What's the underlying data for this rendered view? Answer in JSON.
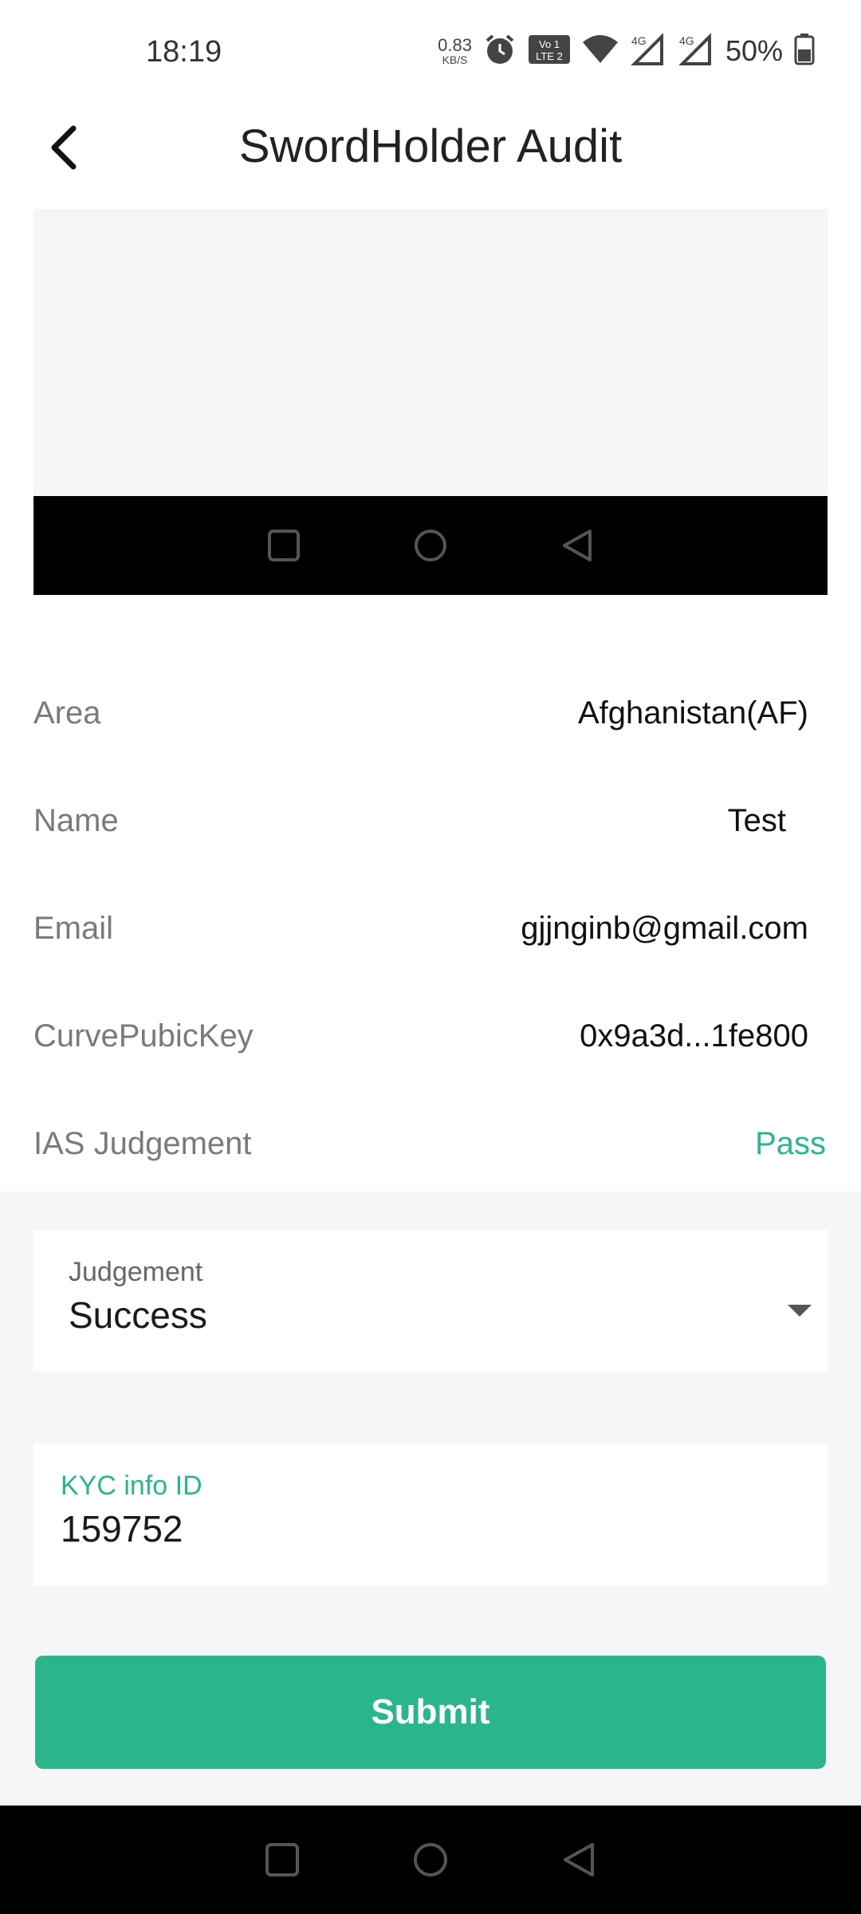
{
  "status_bar": {
    "time": "18:19",
    "net_speed_value": "0.83",
    "net_speed_unit": "KB/S",
    "battery_percent": "50%",
    "icons": [
      "alarm-icon",
      "volte-icon",
      "wifi-icon",
      "signal-4g-icon",
      "signal-4g-icon",
      "battery-icon"
    ]
  },
  "header": {
    "title": "SwordHolder Audit",
    "back_icon": "chevron-left-icon"
  },
  "preview": {
    "nav_icons": [
      "square-icon",
      "circle-icon",
      "triangle-back-icon"
    ]
  },
  "info": {
    "area_label": "Area",
    "area_value": "Afghanistan(AF)",
    "name_label": "Name",
    "name_value": "Test",
    "email_label": "Email",
    "email_value": "gjjnginb@gmail.com",
    "key_label": "CurvePubicKey",
    "key_value": "0x9a3d...1fe800",
    "ias_label": "IAS Judgement",
    "ias_value": "Pass"
  },
  "form": {
    "judgement_label": "Judgement",
    "judgement_value": "Success",
    "kyc_label": "KYC info ID",
    "kyc_value": "159752"
  },
  "submit_label": "Submit",
  "colors": {
    "accent": "#2bb58d",
    "label_gray": "#7a7a7a",
    "form_bg": "#f6f6f6"
  }
}
